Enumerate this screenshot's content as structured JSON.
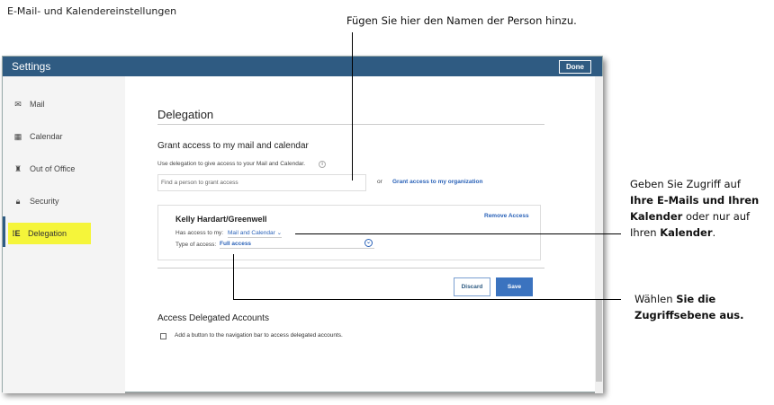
{
  "caption": "E-Mail- und Kalendereinstellungen",
  "callouts": {
    "top": "Fügen Sie hier den Namen der Person hinzu.",
    "access": {
      "l1": "Geben Sie Zugriff auf",
      "l2": "Ihre E-Mails und Ihren",
      "l3a": "Kalender",
      "l3b": " oder nur auf",
      "l4a": "Ihren ",
      "l4b": "Kalender",
      "l4c": "."
    },
    "level": {
      "l1a": "Wählen ",
      "l1b": "Sie die",
      "l2": "Zugriffsebene aus."
    }
  },
  "window": {
    "title": "Settings",
    "done": "Done"
  },
  "sidebar": {
    "items": [
      {
        "label": "Mail",
        "icon": "mail-icon",
        "glyph": "✉"
      },
      {
        "label": "Calendar",
        "icon": "calendar-icon",
        "glyph": "▦"
      },
      {
        "label": "Out of Office",
        "icon": "out-of-office-icon",
        "glyph": "♜"
      },
      {
        "label": "Security",
        "icon": "lock-icon",
        "glyph": "🔒︎"
      },
      {
        "label": "Delegation",
        "icon": "delegation-icon",
        "glyph": "⁞Ε"
      }
    ]
  },
  "main": {
    "title": "Delegation",
    "grant_heading": "Grant access to my mail and calendar",
    "grant_desc": "Use delegation to give access to your Mail and Calendar.",
    "search_placeholder": "Find a person to grant access",
    "or": "or",
    "grant_org": "Grant access to my organization",
    "delegate": {
      "name": "Kelly Hardart/Greenwell",
      "remove": "Remove Access",
      "has_access_label": "Has access to my:",
      "has_access_value": "Mail and Calendar",
      "type_label": "Type of access:",
      "type_value": "Full access"
    },
    "discard": "Discard",
    "save": "Save",
    "accounts_heading": "Access Delegated Accounts",
    "accounts_checkbox": "Add a button to the navigation bar to access delegated accounts."
  }
}
